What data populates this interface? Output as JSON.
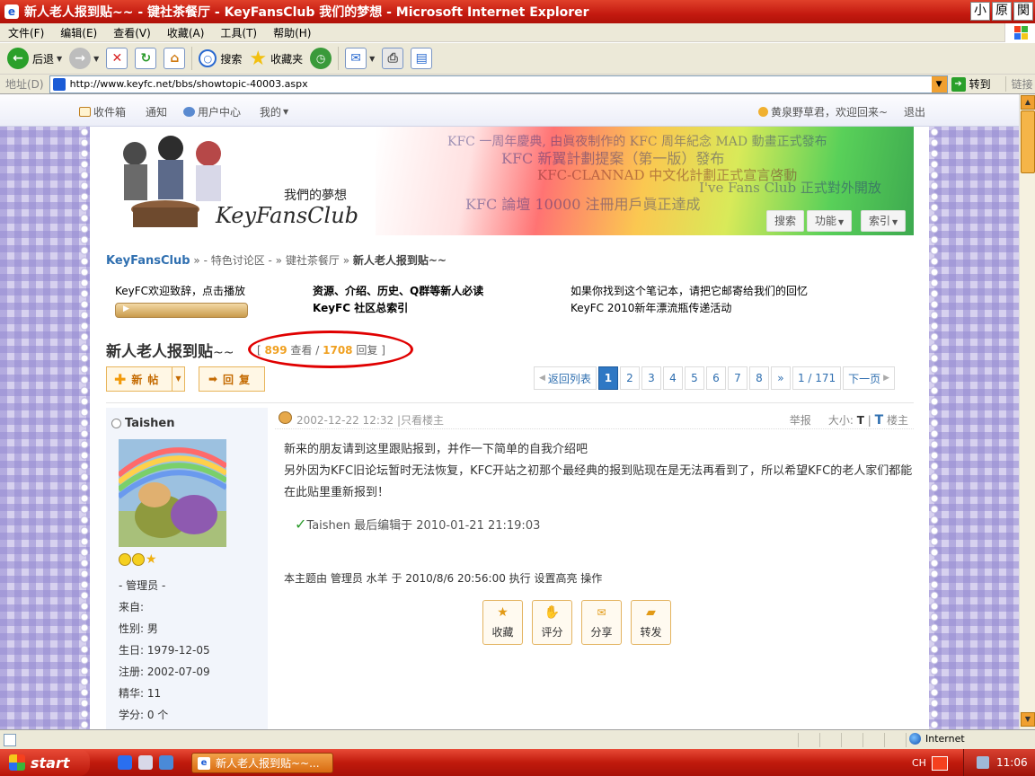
{
  "window": {
    "title": "新人老人报到贴~~ - 键社茶餐厅 - KeyFansClub 我们的梦想 - Microsoft Internet Explorer",
    "buttons": [
      "小",
      "原",
      "関"
    ]
  },
  "menu": [
    "文件(F)",
    "编辑(E)",
    "查看(V)",
    "收藏(A)",
    "工具(T)",
    "帮助(H)"
  ],
  "toolbar": {
    "back": "后退",
    "search": "搜索",
    "favorites": "收藏夹"
  },
  "address": {
    "label": "地址(D)",
    "url": "http://www.keyfc.net/bbs/showtopic-40003.aspx",
    "go": "转到",
    "links": "链接"
  },
  "topnav": {
    "inbox": "收件箱",
    "notify": "通知",
    "user_center": "用户中心",
    "mine": "我的",
    "welcome": "黄泉野草君，欢迎回来~",
    "logout": "退出"
  },
  "banner": {
    "slogan": "我們的夢想",
    "logo": "KeyFansClub",
    "nav": [
      "搜索",
      "功能",
      "索引"
    ],
    "bg_texts": [
      "KFC 一周年慶典, 由眞夜制作的 KFC 周年紀念 MAD 動畫正式發布",
      "KFC 新翼計劃提案（第一版）發布",
      "KFC 論壇 10000 注冊用戶眞正達成",
      "I've Fans Club 正式對外開放",
      "KFC-CLANNAD 中文化計劃正式宣言啓動"
    ]
  },
  "breadcrumb": {
    "home": "KeyFansClub",
    "sep1": "» - 特色讨论区 - »",
    "forum": "键社茶餐厅",
    "sep2": "»",
    "current": "新人老人报到贴~~"
  },
  "notices": {
    "col1": "KeyFC欢迎致辞，点击播放",
    "col2_line1": "资源、介绍、历史、Q群等新人必读",
    "col2_line2": "KeyFC 社区总索引",
    "col3_line1": "如果你找到这个笔记本，请把它邮寄给我们的回忆",
    "col3_line2": "KeyFC 2010新年漂流瓶传递活动"
  },
  "topic": {
    "title": "新人老人报到贴",
    "title_suffix": "~~",
    "stats_open": "[",
    "views": "899",
    "views_label": "查看",
    "divider": "/",
    "replies": "1708",
    "replies_label": "回复",
    "stats_close": "]"
  },
  "actions": {
    "new_post": "新帖",
    "reply": "回复"
  },
  "pager": {
    "back_to_list": "返回列表",
    "pages": [
      "1",
      "2",
      "3",
      "4",
      "5",
      "6",
      "7",
      "8"
    ],
    "current": "1",
    "next_arrow": "»",
    "page_of": "1 / 171",
    "next": "下一页"
  },
  "author": {
    "name": "Taishen",
    "role": "- 管理员 -",
    "fields": [
      "来自:",
      "性别: 男",
      "生日: 1979-12-05",
      "注册:  2002-07-09",
      "精华: 11",
      "学分: 0 个"
    ]
  },
  "post": {
    "date": "2002-12-22 12:32",
    "only_author": "|只看楼主",
    "report": "举报",
    "size_label": "大小:",
    "size_small": "T",
    "size_big": "T",
    "floor": "楼主",
    "line1": "新来的朋友请到这里跟贴报到，并作一下简单的自我介绍吧",
    "line2": "另外因为KFC旧论坛暂时无法恢复，KFC开站之初那个最经典的报到贴现在是无法再看到了，所以希望KFC的老人家们都能在此贴里重新报到！",
    "edited_check": "✓",
    "edited": "Taishen 最后编辑于  2010-01-21 21:19:03",
    "mod_note": "本主题由 管理员 水羊 于 2010/8/6 20:56:00 执行 设置高亮 操作",
    "buttons": [
      "收藏",
      "评分",
      "分享",
      "转发"
    ]
  },
  "status": {
    "zone": "Internet"
  },
  "taskbar": {
    "start": "start",
    "task": "新人老人报到贴~~...",
    "lang": "CH",
    "time": "11:06"
  }
}
